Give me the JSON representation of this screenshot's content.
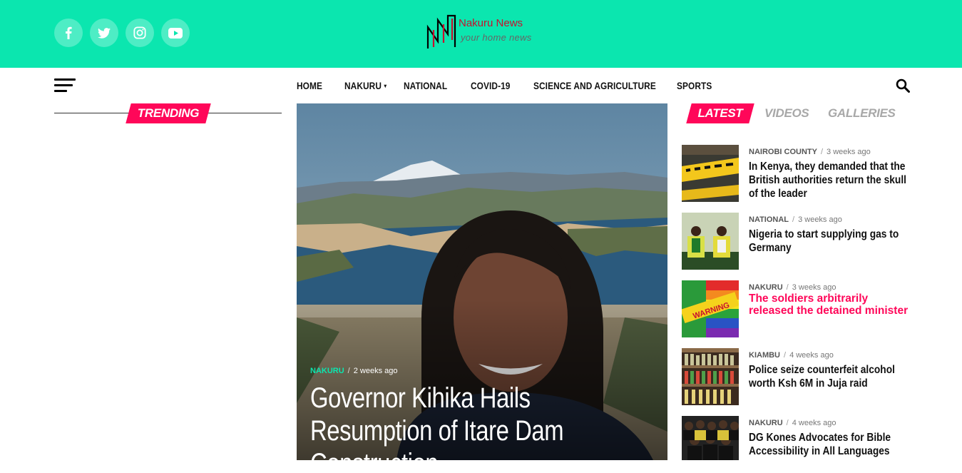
{
  "social": {
    "icons": [
      "facebook-icon",
      "twitter-icon",
      "instagram-icon",
      "youtube-icon"
    ]
  },
  "logo": {
    "title": "Nakuru News",
    "tagline": "your home news"
  },
  "nav": {
    "items": [
      {
        "label": "HOME"
      },
      {
        "label": "NAKURU",
        "has_dropdown": true
      },
      {
        "label": "NATIONAL"
      },
      {
        "label": "COVID-19"
      },
      {
        "label": "SCIENCE AND AGRICULTURE"
      },
      {
        "label": "SPORTS"
      }
    ]
  },
  "trending": {
    "label": "TRENDING"
  },
  "feature": {
    "category": "NAKURU",
    "time": "2 weeks ago",
    "title": "Governor Kihika Hails Resumption of Itare Dam Construction"
  },
  "tabs": {
    "latest": "LATEST",
    "videos": "VIDEOS",
    "galleries": "GALLERIES"
  },
  "latest": [
    {
      "category": "NAIROBI COUNTY",
      "time": "3 weeks ago",
      "title": "In Kenya, they demanded that the British authorities return the skull of the leader"
    },
    {
      "category": "NATIONAL",
      "time": "3 weeks ago",
      "title": "Nigeria to start supplying gas to Germany"
    },
    {
      "category": "NAKURU",
      "time": "3 weeks ago",
      "title": "The soldiers arbitrarily released the detained minister"
    },
    {
      "category": "KIAMBU",
      "time": "4 weeks ago",
      "title": "Police seize counterfeit alcohol worth Ksh 6M in Juja raid"
    },
    {
      "category": "NAKURU",
      "time": "4 weeks ago",
      "title": "DG Kones Advocates for Bible Accessibility in All Languages"
    }
  ],
  "colors": {
    "accent": "#0be6af",
    "highlight": "#ff0759",
    "logo_red": "#c8102e"
  }
}
